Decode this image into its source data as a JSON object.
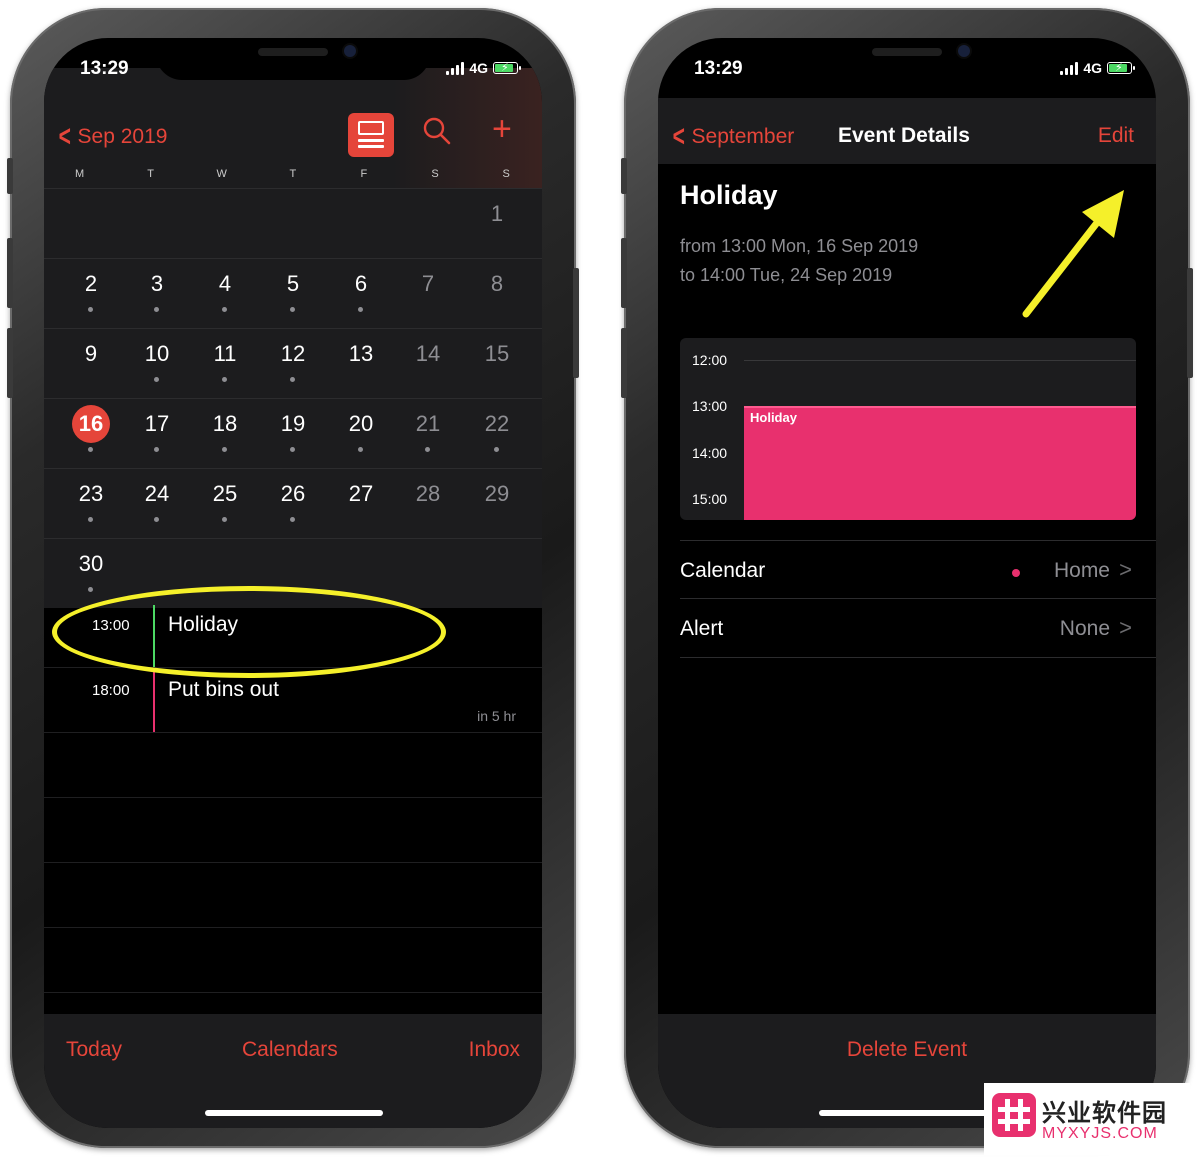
{
  "status": {
    "time": "13:29",
    "network": "4G"
  },
  "left": {
    "nav": {
      "back_label": "Sep 2019"
    },
    "weekdays": [
      "M",
      "T",
      "W",
      "T",
      "F",
      "S",
      "S"
    ],
    "weeks": [
      [
        "",
        "",
        "",
        "",
        "",
        "",
        "1"
      ],
      [
        "2",
        "3",
        "4",
        "5",
        "6",
        "7",
        "8"
      ],
      [
        "9",
        "10",
        "11",
        "12",
        "13",
        "14",
        "15"
      ],
      [
        "16",
        "17",
        "18",
        "19",
        "20",
        "21",
        "22"
      ],
      [
        "23",
        "24",
        "25",
        "26",
        "27",
        "28",
        "29"
      ],
      [
        "30",
        "",
        "",
        "",
        "",
        "",
        ""
      ]
    ],
    "today": "16",
    "events": [
      {
        "time": "13:00",
        "title": "Holiday",
        "sub": "",
        "color": "#4cd964"
      },
      {
        "time": "18:00",
        "title": "Put bins out",
        "sub": "in 5 hr",
        "color": "#e8306e"
      }
    ],
    "tabs": {
      "today": "Today",
      "calendars": "Calendars",
      "inbox": "Inbox"
    }
  },
  "right": {
    "nav": {
      "back_label": "September",
      "title": "Event Details",
      "edit_label": "Edit"
    },
    "event": {
      "title": "Holiday",
      "from": "from 13:00 Mon, 16 Sep 2019",
      "to": "to 14:00 Tue, 24 Sep 2019"
    },
    "timeline": {
      "hours": [
        "12:00",
        "13:00",
        "14:00",
        "15:00"
      ],
      "event_label": "Holiday",
      "event_color": "#e8306e"
    },
    "rows": [
      {
        "label": "Calendar",
        "value": "Home"
      },
      {
        "label": "Alert",
        "value": "None"
      }
    ],
    "delete_label": "Delete Event"
  },
  "watermark": {
    "line1": "兴业软件园",
    "line2": "MYXYJS.COM"
  },
  "colors": {
    "accent": "#e5453a",
    "highlight": "#f5f02a",
    "event_pink": "#e8306e"
  }
}
